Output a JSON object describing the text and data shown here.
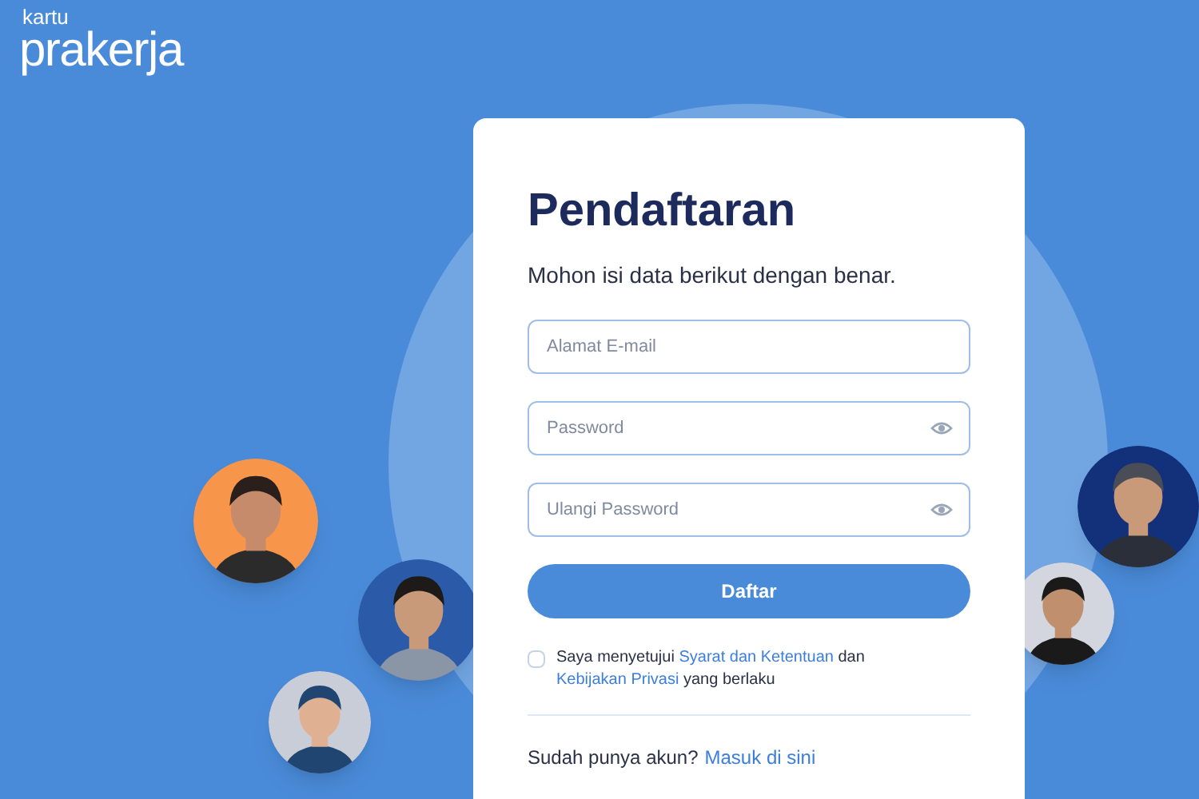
{
  "logo": {
    "small": "kartu",
    "large": "prakerja"
  },
  "form": {
    "title": "Pendaftaran",
    "subtitle": "Mohon isi data berikut dengan benar.",
    "fields": [
      {
        "kind": "email",
        "placeholder": "Alamat E-mail"
      },
      {
        "kind": "password",
        "placeholder": "Password"
      },
      {
        "kind": "password",
        "placeholder": "Ulangi Password"
      }
    ],
    "submit": "Daftar",
    "agreement": {
      "checked": false,
      "parts": [
        {
          "kind": "text",
          "text": "Saya menyetujui"
        },
        {
          "kind": "link",
          "text": "Syarat dan Ketentuan"
        },
        {
          "kind": "text",
          "text": "dan"
        },
        {
          "kind": "link",
          "text": "Kebijakan Privasi"
        },
        {
          "kind": "text",
          "text": "yang berlaku"
        }
      ]
    },
    "login_prompt": "Sudah punya akun?",
    "login_link": "Masuk di sini"
  }
}
